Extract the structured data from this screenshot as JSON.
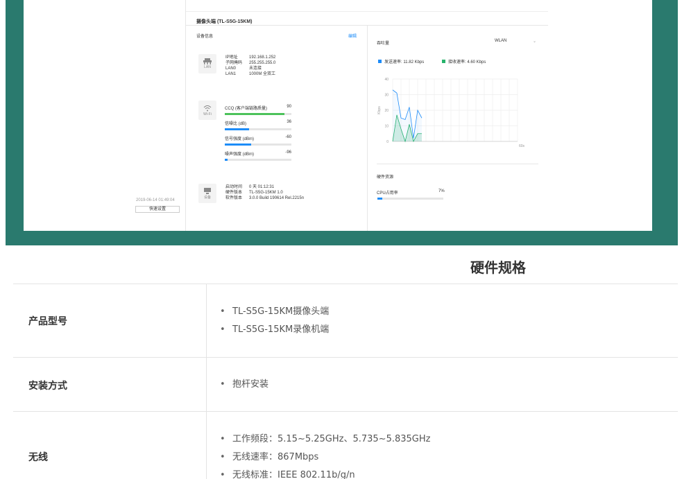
{
  "header": {
    "device_title": "摄像头端 (TL-S5G-15KM)"
  },
  "device_info": {
    "title": "设备信息",
    "edit_link": "编辑",
    "lan": {
      "icon_label": "LAN",
      "rows": [
        {
          "k": "IP地址",
          "v": "192.168.1.252"
        },
        {
          "k": "子网掩码",
          "v": "255.255.255.0"
        },
        {
          "k": "LAN0",
          "v": "未连接"
        },
        {
          "k": "LAN1",
          "v": "1000M 全双工"
        }
      ]
    },
    "wifi": {
      "icon_label": "Wi-Fi",
      "meters": [
        {
          "label": "CCQ (客户端链路质量)",
          "value": "90",
          "fraction": 0.9,
          "color": "#4cc25a"
        },
        {
          "label": "信噪比 (dB)",
          "value": "36",
          "fraction": 0.36,
          "color": "#1d8cf8"
        },
        {
          "label": "信号强度 (dBm)",
          "value": "-60",
          "fraction": 0.4,
          "color": "#1d8cf8"
        },
        {
          "label": "噪声强度 (dBm)",
          "value": "-96",
          "fraction": 0.04,
          "color": "#1d8cf8"
        }
      ]
    },
    "device": {
      "icon_label": "设备",
      "rows": [
        {
          "k": "启动时间",
          "v": "0 天 01:12:31"
        },
        {
          "k": "硬件版本",
          "v": "TL-S5G-15KM 1.0"
        },
        {
          "k": "软件版本",
          "v": "3.0.0 Build 190614 Rel.2215n"
        }
      ]
    }
  },
  "sidebar": {
    "datetime": "2019-06-14 01:49:04",
    "quick_setup_button": "快速设置"
  },
  "throughput": {
    "title": "吞吐量",
    "select_value": "WLAN",
    "legend_send": "发送速率: 11.82 Kbps",
    "legend_recv": "接收速率: 4.60 Kbps",
    "send_color": "#1d8cf8",
    "recv_color": "#27b36b"
  },
  "chart_data": {
    "type": "area",
    "ylabel": "Kbps",
    "ylim": [
      0,
      40
    ],
    "yticks": [
      "40",
      "30",
      "20",
      "10",
      "0"
    ],
    "x_end_label": "60s",
    "x": [
      0,
      2,
      4,
      6,
      8,
      10,
      12,
      14,
      16,
      18
    ],
    "series": [
      {
        "name": "发送速率",
        "values": [
          33,
          31,
          15,
          14,
          22,
          2,
          20,
          15,
          null,
          null
        ]
      },
      {
        "name": "接收速率",
        "values": [
          0,
          17,
          8,
          0,
          11,
          0,
          5,
          5,
          null,
          null
        ]
      }
    ],
    "grid": true
  },
  "hardware_resources": {
    "title": "硬件资源",
    "cpu_label": "CPU占用率",
    "cpu_value": "7%",
    "cpu_fraction": 0.07
  },
  "spec": {
    "title": "硬件规格",
    "rows": [
      {
        "label": "产品型号",
        "items": [
          "TL-S5G-15KM摄像头端",
          "TL-S5G-15KM录像机端"
        ]
      },
      {
        "label": "安装方式",
        "items": [
          "抱杆安装"
        ]
      },
      {
        "label": "无线",
        "items": [
          "工作频段：5.15~5.25GHz、5.735~5.835GHz",
          "无线速率：867Mbps",
          "无线标准：IEEE 802.11b/g/n"
        ]
      }
    ]
  }
}
